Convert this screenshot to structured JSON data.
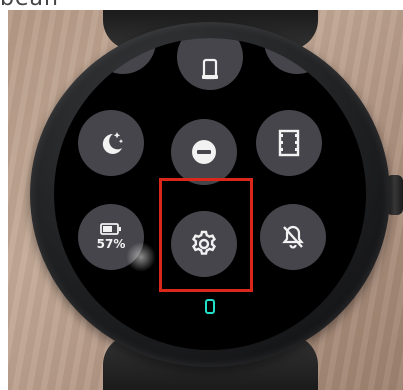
{
  "top_cut_text": "bean",
  "tiles": {
    "battery_label": "57%"
  },
  "icons": {
    "phone": "phone-icon",
    "bedtime": "bedtime-moon-icon",
    "do_not_disturb": "do-not-disturb-icon",
    "theater_mode": "theater-mode-icon",
    "battery": "battery-icon",
    "settings": "settings-gear-icon",
    "notifications_off": "notifications-off-icon"
  },
  "colors": {
    "tile_background": "#45454b",
    "icon_color": "#f2f2f2",
    "highlight_box": "#d9271c",
    "page_indicator": "#1fe0c8"
  }
}
